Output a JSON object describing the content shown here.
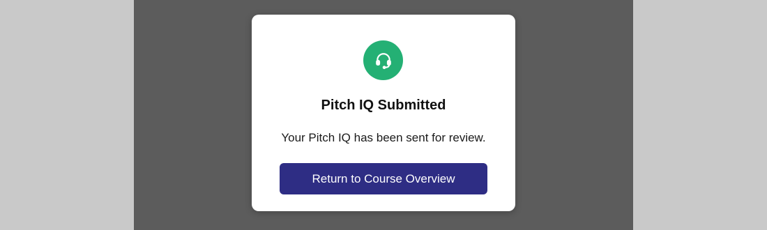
{
  "modal": {
    "icon": "headset-icon",
    "title": "Pitch IQ Submitted",
    "message": "Your Pitch IQ has been sent for review.",
    "primary_button_label": "Return to Course Overview"
  },
  "colors": {
    "icon_background": "#24b074",
    "button_background": "#2e2d84",
    "overlay": "#5c5c5c",
    "page_background": "#c9c9c9"
  }
}
